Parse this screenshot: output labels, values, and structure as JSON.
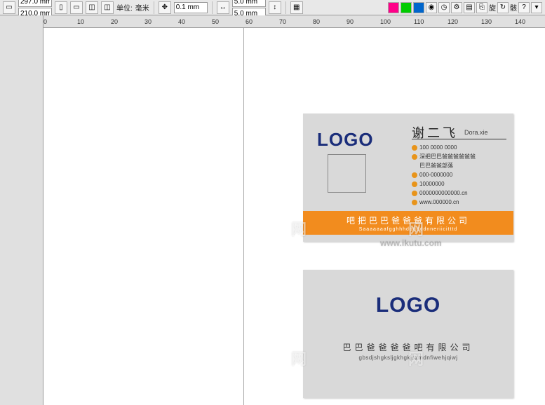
{
  "toolbar": {
    "page_w": "297.0 mm",
    "page_h": "210.0 mm",
    "units_label": "单位:",
    "units_value": "毫米",
    "nudge": "0.1 mm",
    "dup_x": "5.0 mm",
    "dup_y": "5.0 mm",
    "rotate_label": "旋",
    "cn_btn": "骸"
  },
  "ruler_ticks": [
    "0",
    "10",
    "20",
    "30",
    "40",
    "50",
    "60",
    "70",
    "80",
    "90",
    "100",
    "110",
    "120",
    "130",
    "140"
  ],
  "card_front": {
    "logo": "LOGO",
    "name": "谢二飞",
    "name_en": "Dora.xie",
    "info": [
      "100 0000 0000",
      "深把巴巴爸爸爸爸爸爸",
      "巴巴爸爸部落",
      "000-0000000",
      "10000000",
      "0000000000000.cn",
      "www.000000.cn"
    ],
    "company_cn": "吧把巴巴爸爸爸有限公司",
    "company_en": "Saaaaaaafgghhhddddddnneriicitttd"
  },
  "card_back": {
    "logo": "LOGO",
    "company_cn": "巴巴爸爸爸爸吧有限公司",
    "company_en": "gbsdjshgksljgkhgkjszmdnfiwehjqiwj"
  },
  "watermarks": {
    "left_edge": "网",
    "site": "www.ikutu.com"
  }
}
